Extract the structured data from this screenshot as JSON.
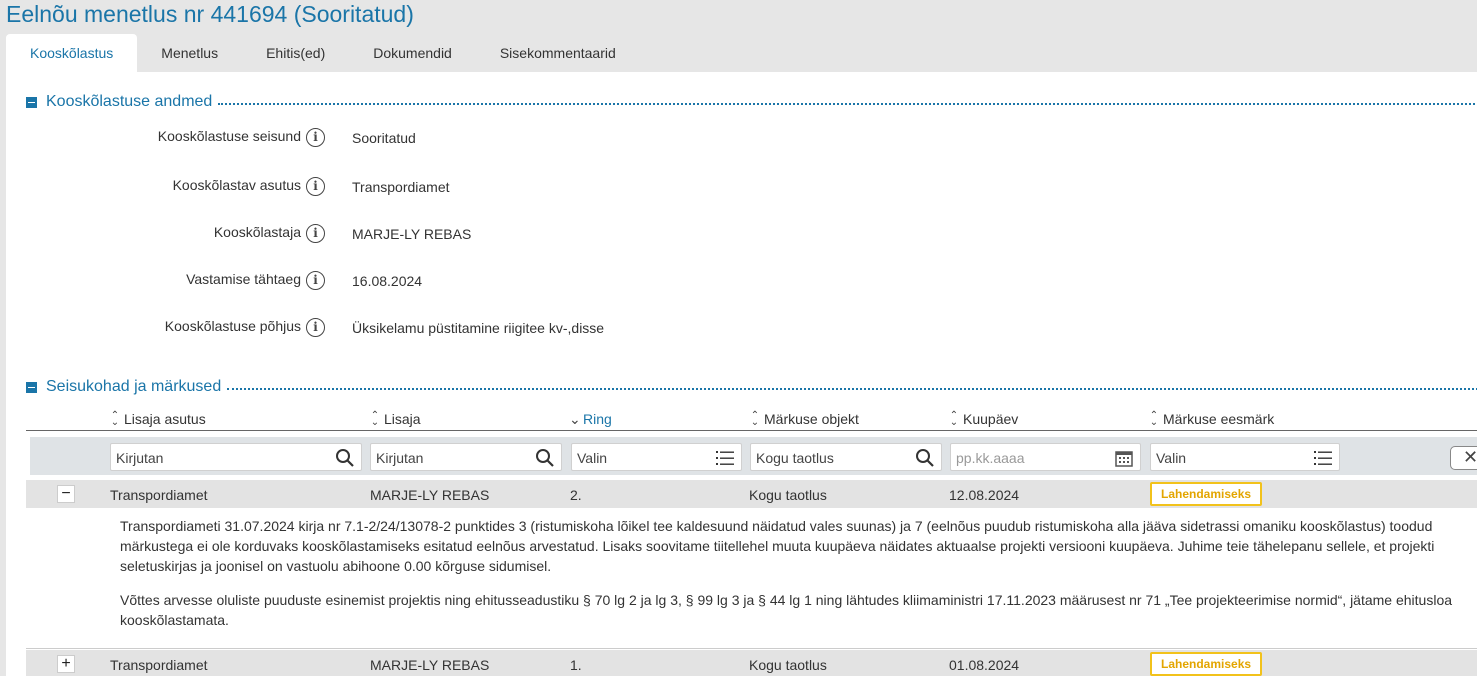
{
  "title": "Eelnõu menetlus nr 441694 (Sooritatud)",
  "tabs": [
    "Kooskõlastus",
    "Menetlus",
    "Ehitis(ed)",
    "Dokumendid",
    "Sisekommentaarid"
  ],
  "section1": {
    "title": "Kooskõlastuse andmed",
    "fields": [
      {
        "label": "Kooskõlastuse seisund",
        "value": "Sooritatud"
      },
      {
        "label": "Kooskõlastav asutus",
        "value": "Transpordiamet"
      },
      {
        "label": "Kooskõlastaja",
        "value": "MARJE-LY REBAS"
      },
      {
        "label": "Vastamise tähtaeg",
        "value": "16.08.2024"
      },
      {
        "label": "Kooskõlastuse põhjus",
        "value": "Üksikelamu püstitamine riigitee kv-,disse"
      }
    ]
  },
  "section2": {
    "title": "Seisukohad ja märkused",
    "columns": [
      "Lisaja asutus",
      "Lisaja",
      "Ring",
      "Märkuse objekt",
      "Kuupäev",
      "Märkuse eesmärk"
    ],
    "filters": [
      "Kirjutan",
      "Kirjutan",
      "Valin",
      "Kogu taotlus",
      "pp.kk.aaaa",
      "Valin"
    ],
    "clear_label": "✕",
    "rows": [
      {
        "toggle": "−",
        "asutus": "Transpordiamet",
        "lisaja": "MARJE-LY REBAS",
        "ring": "2.",
        "objekt": "Kogu taotlus",
        "kuupaev": "12.08.2024",
        "eesmark": "Lahendamiseks"
      },
      {
        "toggle": "+",
        "asutus": "Transpordiamet",
        "lisaja": "MARJE-LY REBAS",
        "ring": "1.",
        "objekt": "Kogu taotlus",
        "kuupaev": "01.08.2024",
        "eesmark": "Lahendamiseks"
      }
    ],
    "detail": {
      "p1": "Transpordiameti 31.07.2024 kirja nr 7.1-2/24/13078-2 punktides 3 (ristumiskoha lõikel tee kaldesuund näidatud vales suunas) ja 7 (eelnõus puudub ristumiskoha alla jääva sidetrassi omaniku kooskõlastus) toodud märkustega ei ole korduvaks kooskõlastamiseks esitatud eelnõus arvestatud. Lisaks soovitame tiitellehel muuta kuupäeva näidates aktuaalse projekti versiooni kuupäeva. Juhime teie tähelepanu sellele, et projekti seletuskirjas ja joonisel on vastuolu abihoone 0.00 kõrguse sidumisel.",
      "p2a": "Võttes arvesse oluliste puuduste esinemist projektis ning ehitusseadustiku § 70 lg 2 ja lg 3, § 99 lg 3 ja § 44 lg 1 ning lähtudes kliimaministri 17.11.2023 määrusest nr 71 „Tee projekteerimise normid“, jätame ehitusloa",
      "p2b": "kooskõlastamata."
    }
  },
  "colors": {
    "accent": "#1a75a8",
    "badge": "#f2c21b"
  }
}
